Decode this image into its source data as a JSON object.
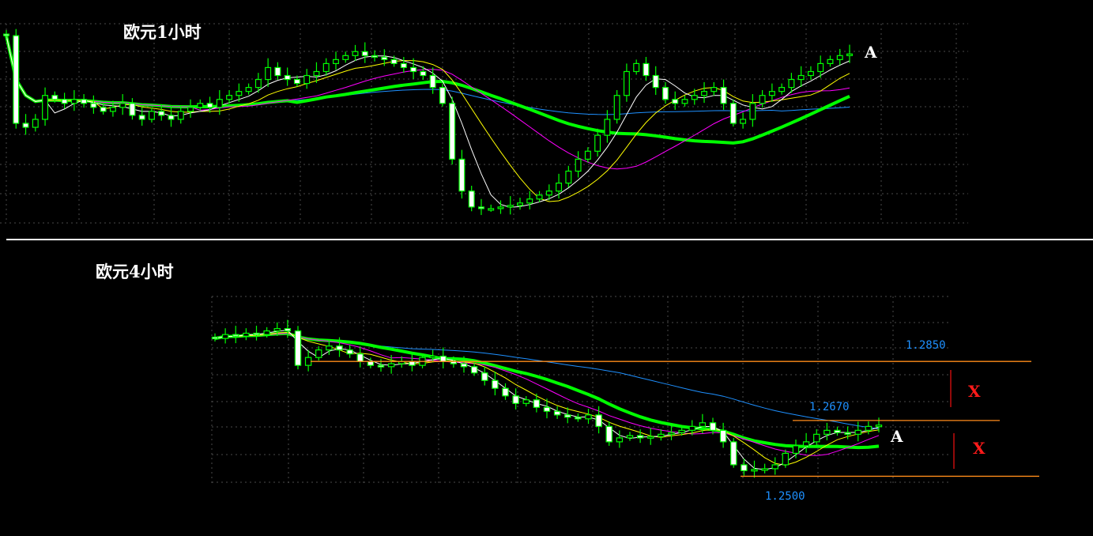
{
  "chart_data": [
    {
      "type": "candlestick",
      "title": "欧元1小时",
      "ylim": [
        1.239,
        1.289
      ],
      "grid": true,
      "annotations": [
        {
          "label": "A"
        }
      ],
      "ma_colors": [
        "#ffffff",
        "#ffff00",
        "#ff00ff",
        "#00ff00",
        "#1e90ff"
      ],
      "ma_periods": [
        5,
        10,
        20,
        30,
        80
      ],
      "closes": [
        1.286,
        1.264,
        1.263,
        1.265,
        1.271,
        1.27,
        1.269,
        1.27,
        1.269,
        1.268,
        1.267,
        1.268,
        1.269,
        1.266,
        1.265,
        1.267,
        1.266,
        1.265,
        1.267,
        1.268,
        1.269,
        1.268,
        1.27,
        1.271,
        1.272,
        1.273,
        1.275,
        1.278,
        1.276,
        1.275,
        1.274,
        1.276,
        1.277,
        1.279,
        1.28,
        1.281,
        1.282,
        1.281,
        1.2806,
        1.28,
        1.279,
        1.278,
        1.277,
        1.276,
        1.273,
        1.269,
        1.255,
        1.247,
        1.243,
        1.2426,
        1.2426,
        1.243,
        1.2434,
        1.244,
        1.245,
        1.246,
        1.247,
        1.249,
        1.252,
        1.255,
        1.257,
        1.261,
        1.265,
        1.271,
        1.277,
        1.279,
        1.276,
        1.273,
        1.27,
        1.269,
        1.27,
        1.271,
        1.272,
        1.273,
        1.269,
        1.264,
        1.265,
        1.269,
        1.271,
        1.272,
        1.273,
        1.275,
        1.276,
        1.277,
        1.279,
        1.28,
        1.281,
        1.2814
      ]
    },
    {
      "type": "candlestick",
      "title": "欧元4小时",
      "ylim": [
        1.2477,
        1.3048
      ],
      "grid": true,
      "levels": [
        {
          "value": 1.285,
          "label": "1.2850"
        },
        {
          "value": 1.267,
          "label": "1.2670"
        },
        {
          "value": 1.25,
          "label": "1.2500"
        }
      ],
      "annotations": [
        {
          "label": "A"
        },
        {
          "label": "X"
        },
        {
          "label": "X"
        }
      ],
      "level_color": "#ff8c1a",
      "ma_colors": [
        "#ffffff",
        "#ffff00",
        "#ff00ff",
        "#00ff00",
        "#1e90ff"
      ],
      "ma_periods": [
        3,
        6,
        10,
        15,
        40
      ],
      "closes": [
        1.292,
        1.2932,
        1.2927,
        1.2936,
        1.2932,
        1.2943,
        1.295,
        1.2943,
        1.2838,
        1.2862,
        1.2885,
        1.2897,
        1.2885,
        1.2873,
        1.285,
        1.2838,
        1.2834,
        1.2843,
        1.285,
        1.2838,
        1.2862,
        1.2866,
        1.285,
        1.2843,
        1.2834,
        1.2815,
        1.2792,
        1.2768,
        1.2745,
        1.2722,
        1.2733,
        1.271,
        1.2698,
        1.2687,
        1.268,
        1.2675,
        1.2687,
        1.2652,
        1.2605,
        1.2617,
        1.2624,
        1.2617,
        1.2621,
        1.2628,
        1.2633,
        1.264,
        1.2652,
        1.2663,
        1.264,
        1.2605,
        1.2535,
        1.2517,
        1.2521,
        1.2523,
        1.2535,
        1.257,
        1.2593,
        1.2605,
        1.2628,
        1.264,
        1.2633,
        1.2628,
        1.264,
        1.2652,
        1.2656
      ]
    }
  ]
}
